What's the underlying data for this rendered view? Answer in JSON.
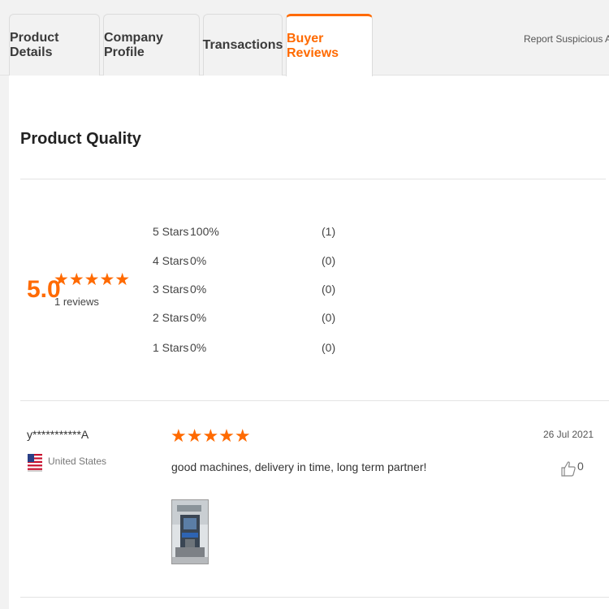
{
  "tabs": [
    {
      "label": "Product Details",
      "active": false
    },
    {
      "label": "Company Profile",
      "active": false
    },
    {
      "label": "Transactions",
      "active": false
    },
    {
      "label": "Buyer Reviews",
      "active": true
    }
  ],
  "report_link": "Report Suspicious Activity",
  "section_title": "Product Quality",
  "summary": {
    "score": "5.0",
    "stars": "★★★★★",
    "rating_fraction": 1.0,
    "review_count": "1 reviews"
  },
  "distribution": [
    {
      "label": "5 Stars",
      "percent": "100%",
      "count": "(1)"
    },
    {
      "label": "4 Stars",
      "percent": "0%",
      "count": "(0)"
    },
    {
      "label": "3 Stars",
      "percent": "0%",
      "count": "(0)"
    },
    {
      "label": "2 Stars",
      "percent": "0%",
      "count": "(0)"
    },
    {
      "label": "1 Stars",
      "percent": "0%",
      "count": "(0)"
    }
  ],
  "review": {
    "reviewer": "y***********A",
    "country": "United States",
    "flag_icon": "us-flag-icon",
    "stars": "★★★★★",
    "rating": 5,
    "text": "good machines, delivery in time, long term partner!",
    "date": "26 Jul 2021",
    "likes": "0"
  },
  "colors": {
    "accent": "#ff6a00",
    "tab_bg": "#f2f2f2",
    "divider": "#e3e3e3"
  }
}
